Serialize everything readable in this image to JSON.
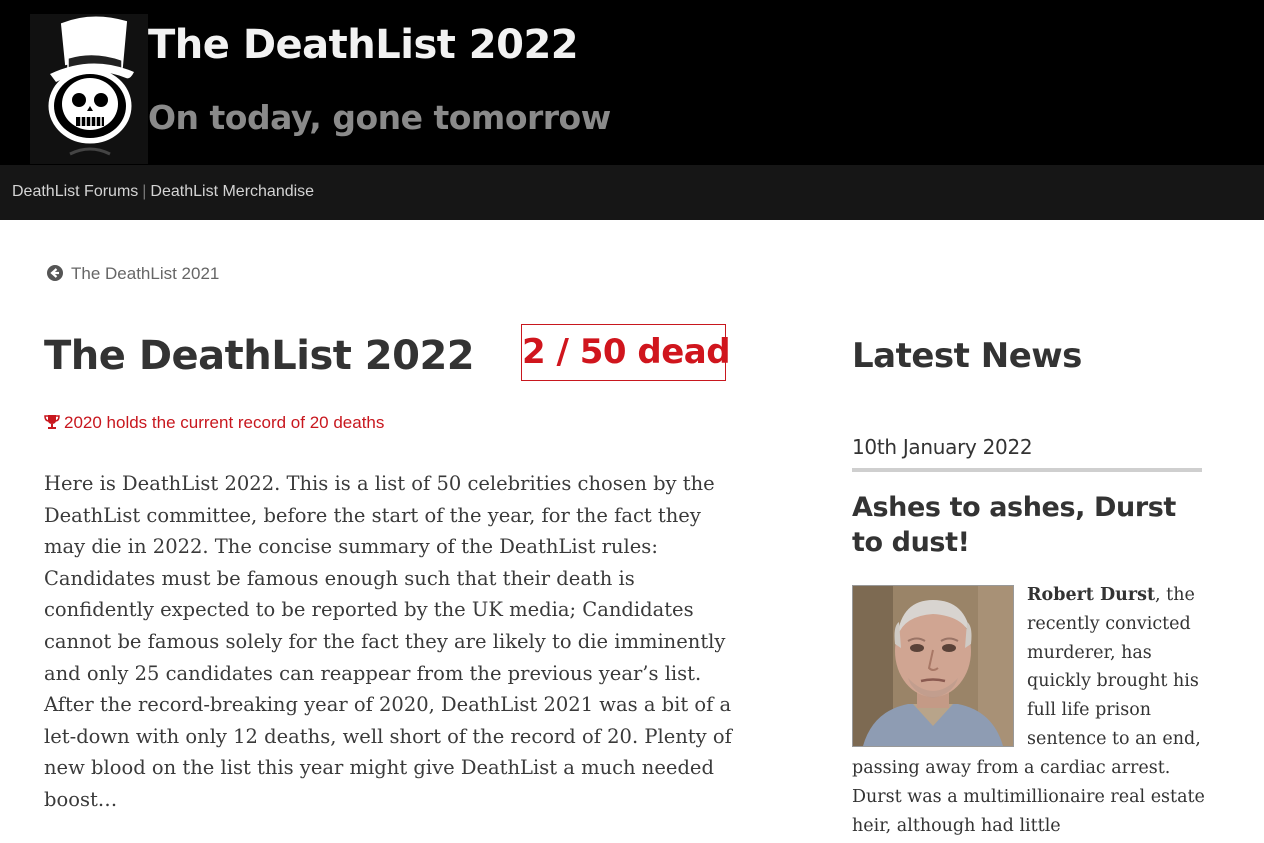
{
  "header": {
    "title": "The DeathList 2022",
    "tagline": "On today, gone tomorrow"
  },
  "nav": {
    "items": [
      {
        "label": "DeathList Forums"
      },
      {
        "label": "DeathList Merchandise"
      }
    ],
    "separator": "|"
  },
  "back_link": {
    "label": "The DeathList 2021",
    "icon": "arrow-circle-left-icon"
  },
  "main": {
    "title": "The DeathList 2022",
    "dead_counter": "2 / 50 dead",
    "record_note": "2020 holds the current record of 20 deaths",
    "record_icon": "trophy-icon",
    "intro": "Here is DeathList 2022. This is a list of 50 celebrities chosen by the DeathList committee, before the start of the year, for the fact they may die in 2022. The concise summary of the DeathList rules: Candidates must be famous enough such that their death is confidently expected to be reported by the UK media; Candidates cannot be famous solely for the fact they are likely to die imminently and only 25 candidates can reappear from the previous year’s list. After the record-breaking year of 2020, DeathList 2021 was a bit of a let-down with only 12 deaths, well short of the record of 20. Plenty of new blood on the list this year might give DeathList a much needed boost…"
  },
  "sidebar": {
    "title": "Latest News",
    "news": {
      "date": "10th January 2022",
      "headline": "Ashes to ashes, Durst to dust!",
      "name": "Robert Durst",
      "body_top": ", the recently convicted murderer, has quickly brought his full life prison sentence to an end,",
      "body_bottom": "passing away from a cardiac arrest. Durst was a multimillionaire real estate heir, although had little"
    }
  },
  "colors": {
    "header_bg": "#000000",
    "nav_bg": "#161616",
    "accent_red": "#c8171e",
    "text_dark": "#333333"
  }
}
